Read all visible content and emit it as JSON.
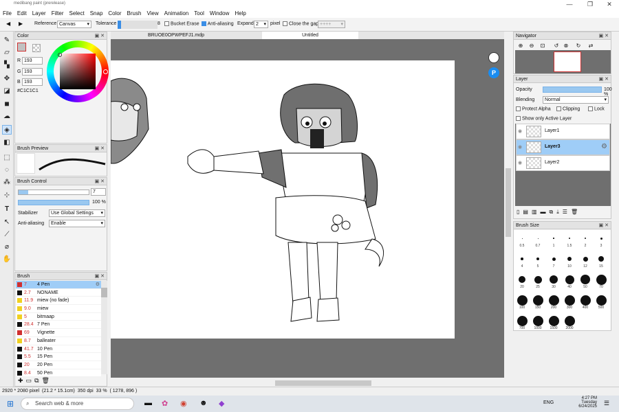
{
  "window": {
    "title": "medibang paint (prerelease)",
    "btn_min": "—",
    "btn_max": "❐",
    "btn_close": "✕"
  },
  "menu": [
    "File",
    "Edit",
    "Layer",
    "Filter",
    "Select",
    "Snap",
    "Color",
    "Brush",
    "View",
    "Animation",
    "Tool",
    "Window",
    "Help"
  ],
  "toolbar": {
    "reference_label": "Reference",
    "reference_value": "Canvas",
    "tolerance_label": "Tolerance",
    "tolerance_value": "8",
    "bucket_erase": "Bucket Erase",
    "anti_aliasing": "Anti-aliasing",
    "expand_label": "Expand",
    "expand_value": "2",
    "expand_unit": "pixel",
    "close_gap": "Close the gap",
    "gap_value": "++++"
  },
  "tabs": [
    "BRUOE0OPWPEFJ1.mdp",
    "Untitled"
  ],
  "color_panel": {
    "title": "Color",
    "r_label": "R",
    "g_label": "G",
    "b_label": "B",
    "r": "193",
    "g": "193",
    "b": "193",
    "hex": "#C1C1C1",
    "swatch": "#C1C1C1"
  },
  "brush_preview": {
    "title": "Brush Preview"
  },
  "brush_control": {
    "title": "Brush Control",
    "size": "7",
    "opacity": "100 %",
    "stabilizer_label": "Stabilizer",
    "stabilizer_value": "Use Global Settings",
    "aa_label": "Anti-aliasing",
    "aa_value": "Enable"
  },
  "brush_panel": {
    "title": "Brush",
    "items": [
      {
        "size": "7",
        "name": "4 Pen",
        "color": "#d03030"
      },
      {
        "size": "2.7",
        "name": "NONAME",
        "color": "#111111"
      },
      {
        "size": "11.9",
        "name": "miew (no fade)",
        "color": "#f0d020"
      },
      {
        "size": "9.0",
        "name": "miew",
        "color": "#f0d020"
      },
      {
        "size": "5",
        "name": "bitmaap",
        "color": "#f0d020"
      },
      {
        "size": "28.4",
        "name": "7 Pen",
        "color": "#111111"
      },
      {
        "size": "69",
        "name": "Vignette",
        "color": "#d03030"
      },
      {
        "size": "8.7",
        "name": "balleater",
        "color": "#f0d020"
      },
      {
        "size": "41.7",
        "name": "10 Pen",
        "color": "#111111"
      },
      {
        "size": "5.5",
        "name": "15 Pen",
        "color": "#111111"
      },
      {
        "size": "20",
        "name": "20 Pen",
        "color": "#111111"
      },
      {
        "size": "8.4",
        "name": "50 Pen",
        "color": "#111111"
      }
    ]
  },
  "navigator": {
    "title": "Navigator"
  },
  "layer_panel": {
    "title": "Layer",
    "opacity_label": "Opacity",
    "opacity_value": "100 %",
    "opacity_fraction": 1.0,
    "blending_label": "Blending",
    "blending_value": "Normal",
    "protect_alpha": "Protect Alpha",
    "clipping": "Clipping",
    "lock": "Lock",
    "show_active": "Show only Active Layer",
    "layers": [
      "Layer1",
      "Layer3",
      "Layer2"
    ]
  },
  "brush_size_panel": {
    "title": "Brush Size",
    "labels": [
      "0.5",
      "0.7",
      "1",
      "1.5",
      "2",
      "3",
      "4",
      "5",
      "7",
      "10",
      "12",
      "15",
      "20",
      "25",
      "30",
      "40",
      "50",
      "70",
      "100",
      "150",
      "200",
      "300",
      "400",
      "500",
      "700",
      "1000",
      "1500",
      "2000"
    ]
  },
  "status": {
    "dims": "2920 * 2080 pixel",
    "cm": "(21.2 * 15.1cm)",
    "dpi": "350 dpi",
    "zoom": "33 %",
    "coords": "( 1278, 896 )"
  },
  "taskbar": {
    "search": "Search web & more",
    "time": "4:27 PM",
    "day": "Tuesday",
    "date": "6/24/2025",
    "weather": "ENG"
  }
}
